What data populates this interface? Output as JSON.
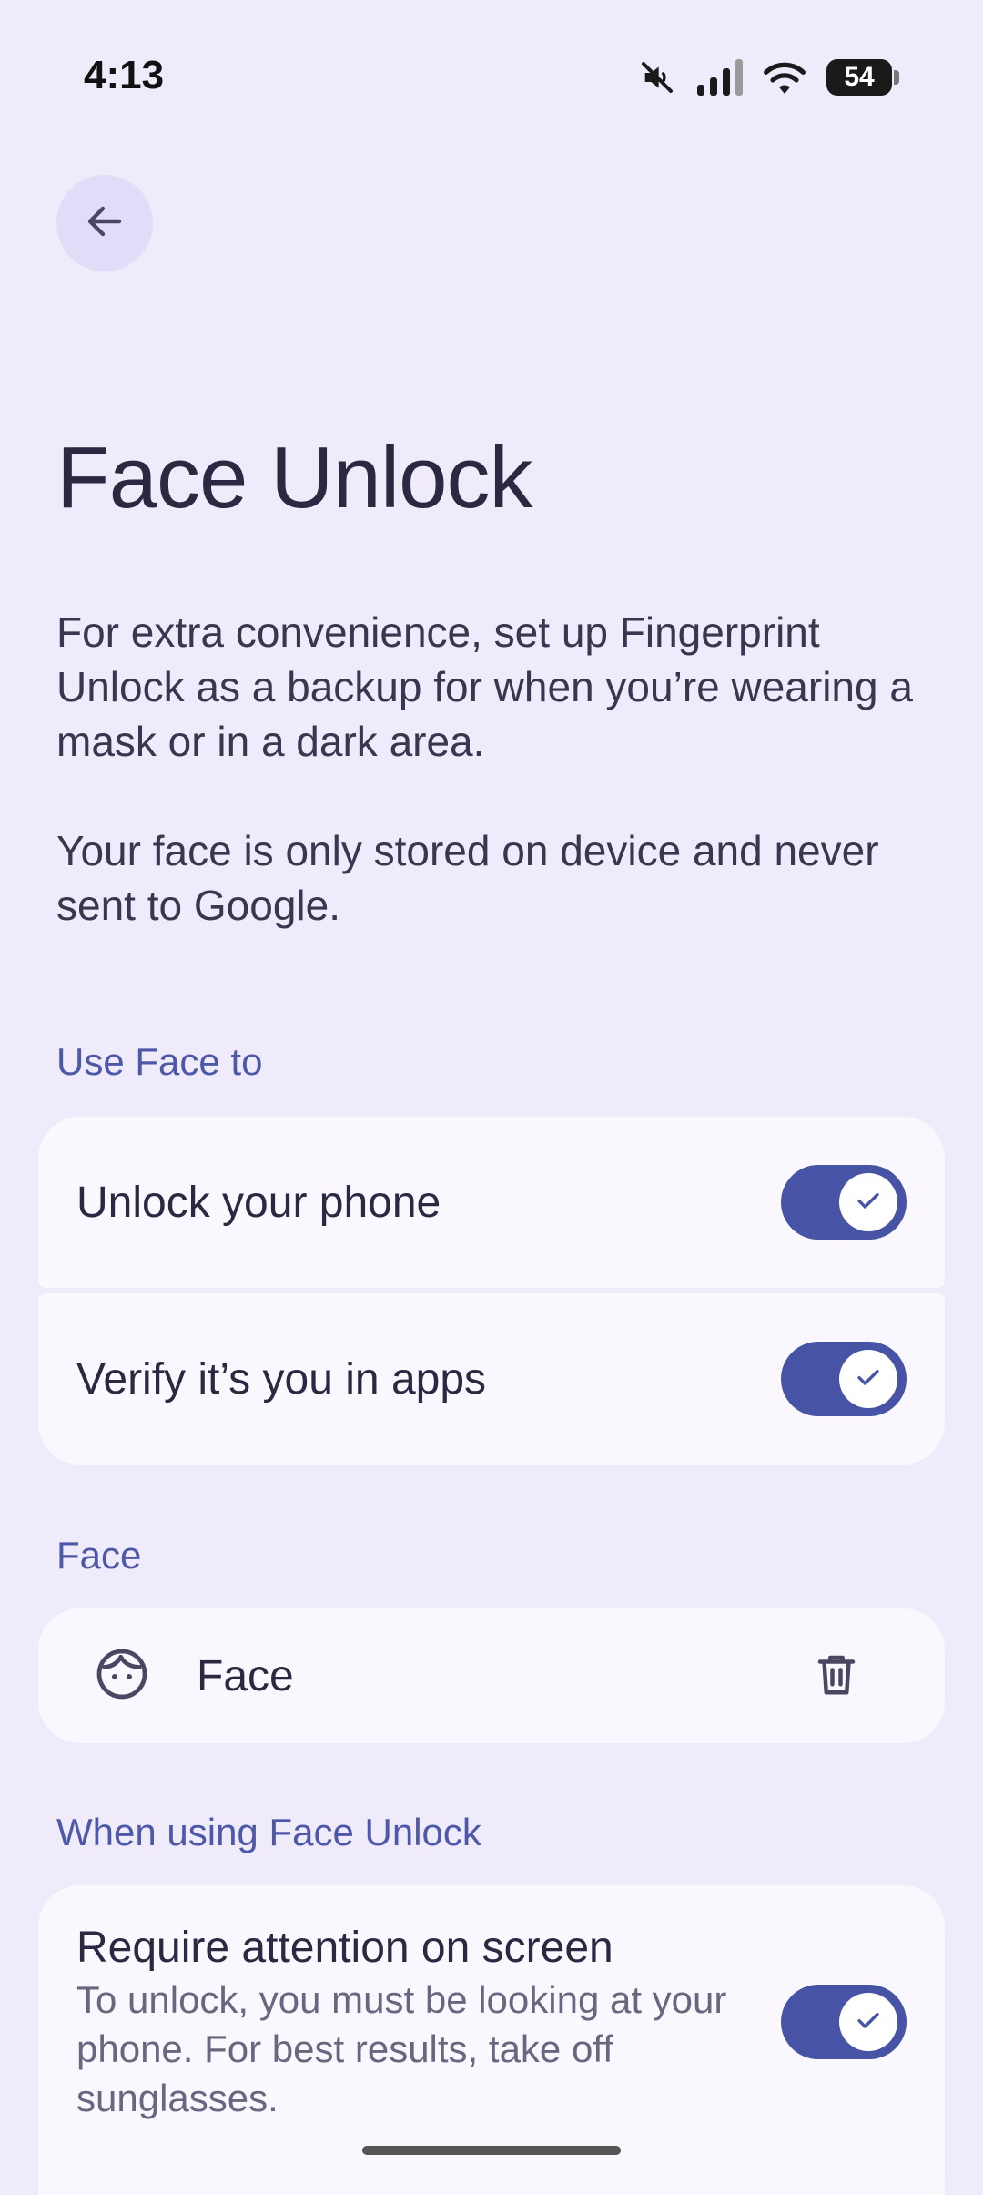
{
  "status_bar": {
    "time": "4:13",
    "battery": "54",
    "icons": [
      "mute-icon",
      "signal-icon",
      "wifi-icon",
      "battery-icon"
    ]
  },
  "header": {
    "back_icon": "arrow-left-icon",
    "title": "Face Unlock"
  },
  "description": {
    "paragraph_1": "For extra convenience, set up Fingerprint Unlock as a backup for when you’re wearing a mask or in a dark area.",
    "paragraph_2": "Your face is only stored on device and never sent to Google."
  },
  "sections": {
    "use_face_to": {
      "header": "Use Face to",
      "items": [
        {
          "label": "Unlock your phone",
          "enabled": true
        },
        {
          "label": "Verify it’s you in apps",
          "enabled": true
        }
      ]
    },
    "face": {
      "header": "Face",
      "item_label": "Face",
      "item_icon": "face-icon",
      "delete_icon": "trash-icon"
    },
    "when_using": {
      "header": "When using Face Unlock",
      "items": [
        {
          "title": "Require attention on screen",
          "subtitle": "To unlock, you must be looking at your phone. For best results, take off sunglasses.",
          "enabled": true
        }
      ]
    }
  },
  "colors": {
    "background": "#efebfb",
    "card": "#faf8fe",
    "accent": "#4753a4",
    "section_header": "#4e58a8"
  }
}
